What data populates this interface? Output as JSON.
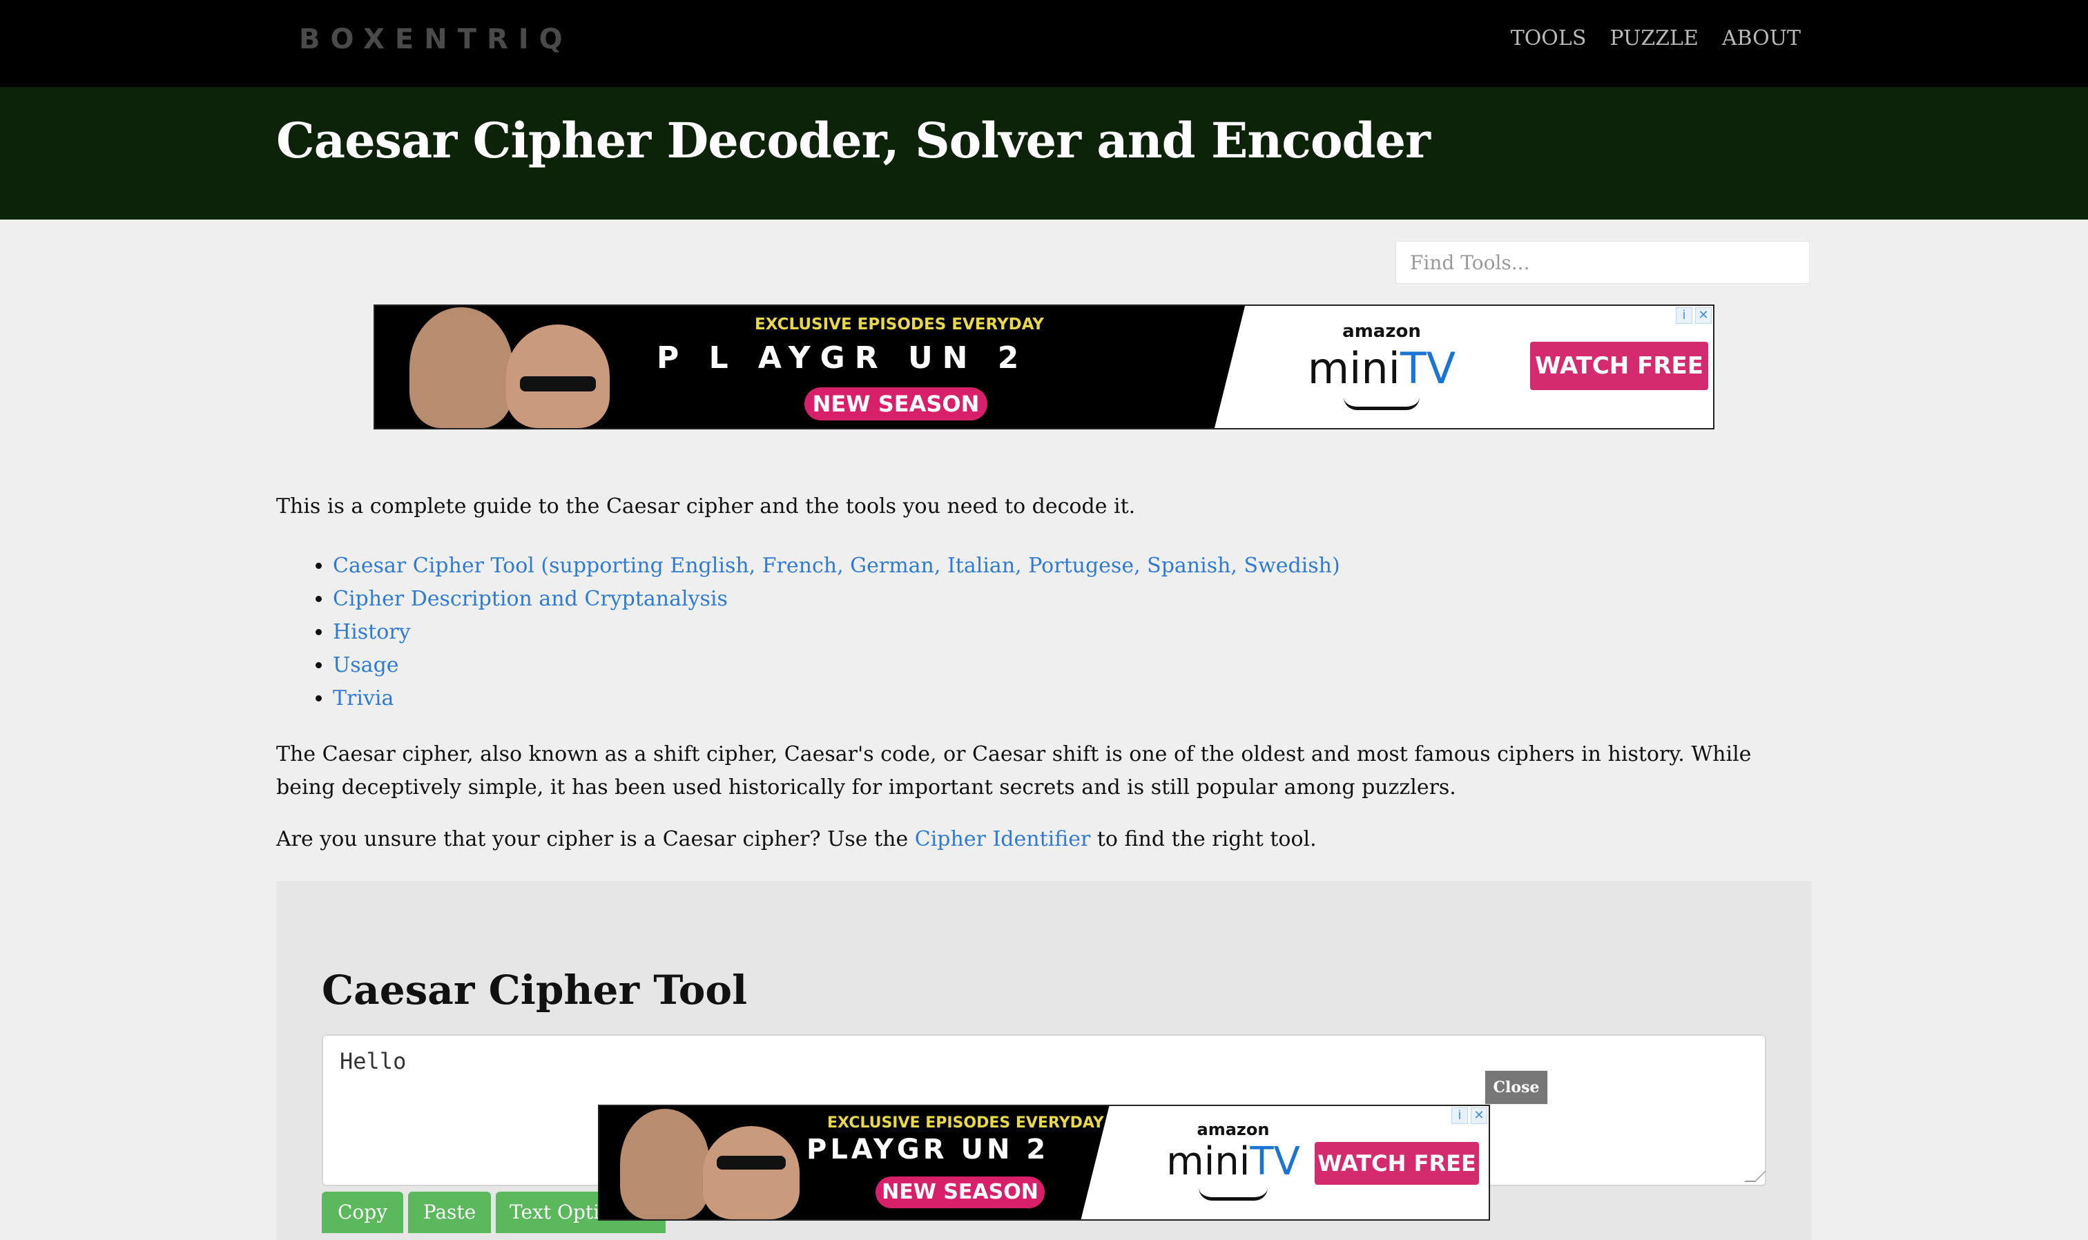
{
  "nav": {
    "logo": "BOXENTRIQ",
    "links": [
      "TOOLS",
      "PUZZLE",
      "ABOUT"
    ]
  },
  "header": {
    "title": "Caesar Cipher Decoder, Solver and Encoder"
  },
  "search": {
    "placeholder": "Find Tools..."
  },
  "ad": {
    "tagline": "EXCLUSIVE EPISODES EVERYDAY",
    "show_top": "P  L  AYGR UN  2",
    "show_bottom": "PLAYGR UN 2",
    "season": "NEW SEASON",
    "amazon": "amazon",
    "brand_prefix": "mini",
    "brand_suffix": "TV",
    "cta": "WATCH FREE",
    "info_icon": "i",
    "close_icon": "✕"
  },
  "content": {
    "intro": "This is a complete guide to the Caesar cipher and the tools you need to decode it.",
    "toc": [
      "Caesar Cipher Tool (supporting English, French, German, Italian, Portugese, Spanish, Swedish)",
      "Cipher Description and Cryptanalysis",
      "History",
      "Usage",
      "Trivia"
    ],
    "description": "The Caesar cipher, also known as a shift cipher, Caesar's code, or Caesar shift is one of the oldest and most famous ciphers in history. While being deceptively simple, it has been used historically for important secrets and is still popular among puzzlers.",
    "unsure_before": "Are you unsure that your cipher is a Caesar cipher? Use the ",
    "unsure_link": "Cipher Identifier",
    "unsure_after": " to find the right tool."
  },
  "tool": {
    "title": "Caesar Cipher Tool",
    "input_value": "Hello",
    "buttons": [
      "Copy",
      "Paste",
      "Text Options..."
    ],
    "close_label": "Close X"
  }
}
